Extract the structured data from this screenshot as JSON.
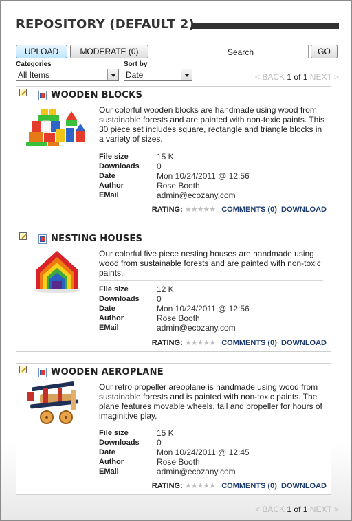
{
  "page": {
    "title": "REPOSITORY (DEFAULT 2)"
  },
  "toolbar": {
    "upload_label": "UPLOAD",
    "moderate_label": "MODERATE (0)",
    "search_label": "Search",
    "search_value": "",
    "go_label": "GO"
  },
  "filters": {
    "categories_label": "Categories",
    "categories_selected": "All Items",
    "sort_label": "Sort by",
    "sort_selected": "Date"
  },
  "pager": {
    "back_label": "< BACK",
    "current": "1",
    "of_label": "of",
    "total": "1",
    "next_label": "NEXT >"
  },
  "items": [
    {
      "title": "WOODEN BLOCKS",
      "description": "Our colorful wooden blocks are handmade using wood from sustainable forests and are painted with non-toxic paints. This 30 piece set includes square, rectangle and triangle blocks in a variety of sizes.",
      "meta_labels": [
        "File size",
        "Downloads",
        "Date",
        "Author",
        "EMail"
      ],
      "meta_values": [
        "15 K",
        "0",
        "Mon 10/24/2011 @ 12:56",
        "Rose Booth",
        "admin@ecozany.com"
      ],
      "rating_label": "RATING:",
      "stars": "★★★★★",
      "comments_label": "COMMENTS (0)",
      "download_label": "DOWNLOAD"
    },
    {
      "title": "NESTING HOUSES",
      "description": "Our colorful five piece nesting houses are handmade using wood from sustainable forests and are painted with non-toxic paints.",
      "meta_labels": [
        "File size",
        "Downloads",
        "Date",
        "Author",
        "EMail"
      ],
      "meta_values": [
        "12 K",
        "0",
        "Mon 10/24/2011 @ 12:56",
        "Rose Booth",
        "admin@ecozany.com"
      ],
      "rating_label": "RATING:",
      "stars": "★★★★★",
      "comments_label": "COMMENTS (0)",
      "download_label": "DOWNLOAD"
    },
    {
      "title": "WOODEN AEROPLANE",
      "description": "Our retro propeller areoplane is handmade using wood from sustainable forests and is painted with non-toxic paints. The plane features movable wheels, tail and propeller for hours of imaginitive play.",
      "meta_labels": [
        "File size",
        "Downloads",
        "Date",
        "Author",
        "EMail"
      ],
      "meta_values": [
        "15 K",
        "0",
        "Mon 10/24/2011 @ 12:45",
        "Rose Booth",
        "admin@ecozany.com"
      ],
      "rating_label": "RATING:",
      "stars": "★★★★★",
      "comments_label": "COMMENTS (0)",
      "download_label": "DOWNLOAD"
    }
  ]
}
